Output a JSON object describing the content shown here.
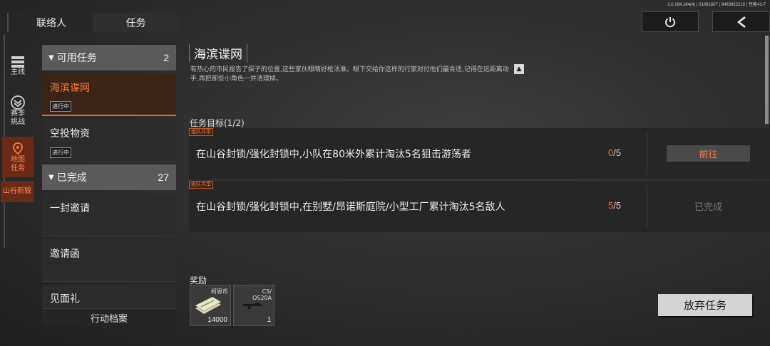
{
  "version": "1.0.164.164(4) | 01061607 | 9483922210 | 性能41-7",
  "tabs": [
    "联络人",
    "任务"
  ],
  "rail": [
    {
      "label": "主线",
      "icon": "list-icon"
    },
    {
      "label": "赛季\n挑战",
      "icon": "chevron-badge-icon"
    },
    {
      "label": "地图\n任务",
      "icon": "map-pin-icon"
    },
    {
      "label": "山谷新貌",
      "icon": ""
    }
  ],
  "groups": {
    "available": {
      "label": "可用任务",
      "count": "2"
    },
    "completed": {
      "label": "已完成",
      "count": "27"
    }
  },
  "available_items": [
    {
      "title": "海滨谍网",
      "badge": "进行中"
    },
    {
      "title": "空投物资",
      "badge": "进行中"
    }
  ],
  "completed_items": [
    {
      "title": "一封邀请"
    },
    {
      "title": "邀请函"
    },
    {
      "title": "见面礼"
    }
  ],
  "footer_tab": "行动档案",
  "mission": {
    "title": "海滨谍网",
    "description": "有热心的市民报告了探子的位置,这些家伙眼睛好枪法准。眼下交给你这样的行家对付他们最合适,记得在远距离动手,再把那些小角色一并清理掉。",
    "objectives_label": "任务目标(1/2)",
    "objectives": [
      {
        "tag": "组队共享",
        "text": "在山谷封锁/强化封锁中,小队在80米外累计淘汰5名狙击游荡者",
        "current": "0",
        "total": "/5",
        "action": "前往"
      },
      {
        "tag": "组队共享",
        "text": "在山谷封锁/强化封锁中,在别墅/昂诺斯庭院/小型工厂累计淘汰5名敌人",
        "current": "5",
        "total": "/5",
        "status": "已完成"
      }
    ],
    "rewards_label": "奖励",
    "rewards": [
      {
        "name": "柯恩币",
        "qty": "14000"
      },
      {
        "name": "CS/\nOS20A",
        "qty": "1"
      }
    ],
    "abandon_label": "放弃任务"
  }
}
